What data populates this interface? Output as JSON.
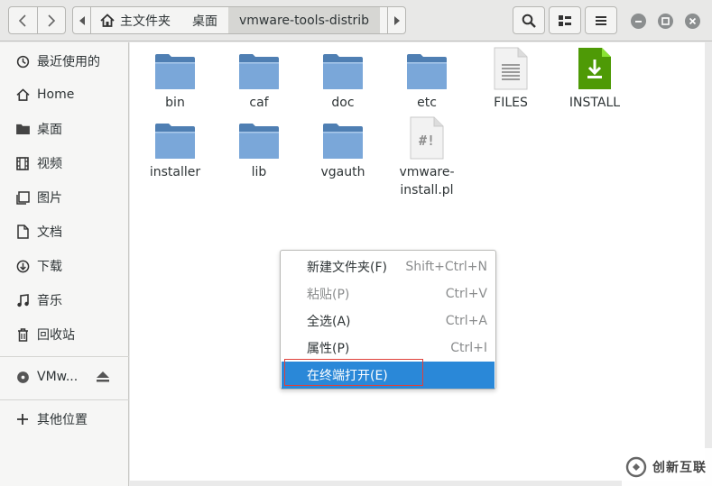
{
  "header": {
    "breadcrumbs": [
      "主文件夹",
      "桌面",
      "vmware-tools-distrib"
    ]
  },
  "sidebar": {
    "items": [
      {
        "label": "最近使用的",
        "icon": "clock-icon"
      },
      {
        "label": "Home",
        "icon": "home-icon"
      },
      {
        "label": "桌面",
        "icon": "folder-icon"
      },
      {
        "label": "视频",
        "icon": "film-icon"
      },
      {
        "label": "图片",
        "icon": "image-icon"
      },
      {
        "label": "文档",
        "icon": "document-icon"
      },
      {
        "label": "下载",
        "icon": "download-icon"
      },
      {
        "label": "音乐",
        "icon": "music-icon"
      },
      {
        "label": "回收站",
        "icon": "trash-icon"
      }
    ],
    "device": {
      "label": "VMw...",
      "icon": "disc-icon"
    },
    "other": {
      "label": "其他位置",
      "icon": "plus-icon"
    }
  },
  "files": [
    {
      "name": "bin",
      "type": "folder"
    },
    {
      "name": "caf",
      "type": "folder"
    },
    {
      "name": "doc",
      "type": "folder"
    },
    {
      "name": "etc",
      "type": "folder"
    },
    {
      "name": "FILES",
      "type": "text"
    },
    {
      "name": "INSTALL",
      "type": "install"
    },
    {
      "name": "installer",
      "type": "folder"
    },
    {
      "name": "lib",
      "type": "folder"
    },
    {
      "name": "vgauth",
      "type": "folder"
    },
    {
      "name": "vmware-install.pl",
      "name_line1": "vmware-",
      "name_line2": "install.pl",
      "type": "script"
    }
  ],
  "context_menu": {
    "items": [
      {
        "label": "新建文件夹(F)",
        "accel": "Shift+Ctrl+N",
        "disabled": false
      },
      {
        "label": "粘贴(P)",
        "accel": "Ctrl+V",
        "disabled": true
      },
      {
        "label": "全选(A)",
        "accel": "Ctrl+A",
        "disabled": false
      },
      {
        "label": "属性(P)",
        "accel": "Ctrl+I",
        "disabled": false
      },
      {
        "label": "在终端打开(E)",
        "accel": "",
        "disabled": false,
        "highlighted": true
      }
    ]
  },
  "watermark": {
    "text": "创新互联"
  },
  "colors": {
    "accent": "#2a88d8",
    "folder": "#6a9fd4",
    "install_green": "#4e9a06",
    "annotation_red": "#e0403a"
  }
}
